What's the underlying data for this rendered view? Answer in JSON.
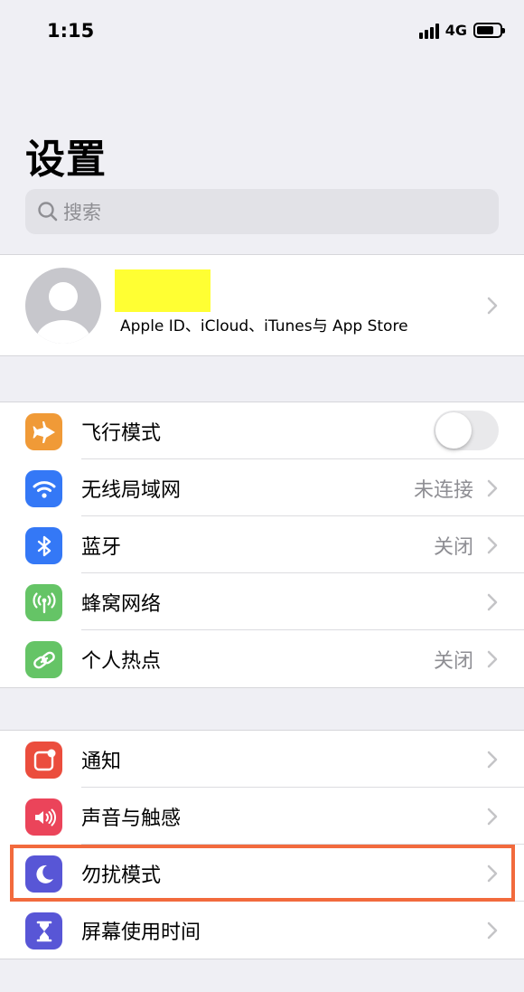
{
  "status_bar": {
    "time": "1:15",
    "network": "4G"
  },
  "page": {
    "title": "设置"
  },
  "search": {
    "placeholder": "搜索"
  },
  "profile": {
    "subtitle": "Apple ID、iCloud、iTunes与 App Store"
  },
  "group1": [
    {
      "label": "飞行模式",
      "value": "",
      "control": "toggle",
      "toggle_on": false,
      "icon": "airplane-icon",
      "color": "#f09a37"
    },
    {
      "label": "无线局域网",
      "value": "未连接",
      "control": "chevron",
      "icon": "wifi-icon",
      "color": "#3478f6"
    },
    {
      "label": "蓝牙",
      "value": "关闭",
      "control": "chevron",
      "icon": "bluetooth-icon",
      "color": "#3478f6"
    },
    {
      "label": "蜂窝网络",
      "value": "",
      "control": "chevron",
      "icon": "cellular-antenna-icon",
      "color": "#65c466"
    },
    {
      "label": "个人热点",
      "value": "关闭",
      "control": "chevron",
      "icon": "hotspot-icon",
      "color": "#65c466"
    }
  ],
  "group2": [
    {
      "label": "通知",
      "value": "",
      "control": "chevron",
      "icon": "notifications-icon",
      "color": "#eb4d3d"
    },
    {
      "label": "声音与触感",
      "value": "",
      "control": "chevron",
      "icon": "speaker-icon",
      "color": "#eb445a"
    },
    {
      "label": "勿扰模式",
      "value": "",
      "control": "chevron",
      "icon": "moon-icon",
      "color": "#5856d6",
      "highlighted": true
    },
    {
      "label": "屏幕使用时间",
      "value": "",
      "control": "chevron",
      "icon": "hourglass-icon",
      "color": "#5856d6"
    }
  ],
  "colors": {
    "highlight_border": "#f26a3d",
    "redacted_name_fill": "#ffff33"
  }
}
